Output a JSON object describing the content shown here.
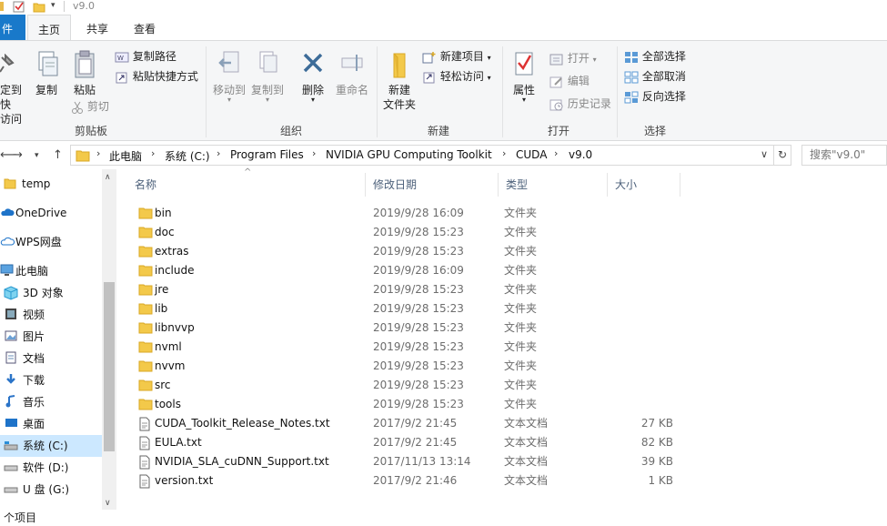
{
  "window": {
    "title": "v9.0"
  },
  "tabs": [
    {
      "label": "件"
    },
    {
      "label": "主页"
    },
    {
      "label": "共享"
    },
    {
      "label": "查看"
    }
  ],
  "ribbon": {
    "clipboard": {
      "pin_label_1": "定到快",
      "pin_label_2": "访问",
      "copy_label": "复制",
      "paste_label": "粘贴",
      "copy_path_label": "复制路径",
      "paste_shortcut_label": "粘贴快捷方式",
      "cut_label": "剪切",
      "group_label": "剪贴板"
    },
    "organize": {
      "move_to_label": "移动到",
      "copy_to_label": "复制到",
      "delete_label": "删除",
      "rename_label": "重命名",
      "group_label": "组织"
    },
    "new": {
      "new_folder_label_1": "新建",
      "new_folder_label_2": "文件夹",
      "new_item_label": "新建项目",
      "easy_access_label": "轻松访问",
      "group_label": "新建"
    },
    "open": {
      "properties_label": "属性",
      "open_label": "打开",
      "edit_label": "编辑",
      "history_label": "历史记录",
      "group_label": "打开"
    },
    "select": {
      "select_all_label": "全部选择",
      "select_none_label": "全部取消",
      "invert_label": "反向选择",
      "group_label": "选择"
    }
  },
  "address": {
    "crumbs": [
      "此电脑",
      "系统 (C:)",
      "Program Files",
      "NVIDIA GPU Computing Toolkit",
      "CUDA",
      "v9.0"
    ],
    "search_placeholder": "搜索\"v9.0\""
  },
  "nav": {
    "items": [
      {
        "label": "temp",
        "icon": "folder-icon"
      },
      {
        "label": "OneDrive",
        "icon": "cloud-icon"
      },
      {
        "label": "WPS网盘",
        "icon": "cloud-icon"
      },
      {
        "label": "此电脑",
        "icon": "computer-icon"
      },
      {
        "label": "3D 对象",
        "icon": "cube-icon"
      },
      {
        "label": "视频",
        "icon": "video-icon"
      },
      {
        "label": "图片",
        "icon": "picture-icon"
      },
      {
        "label": "文档",
        "icon": "document-icon"
      },
      {
        "label": "下载",
        "icon": "download-icon"
      },
      {
        "label": "音乐",
        "icon": "music-icon"
      },
      {
        "label": "桌面",
        "icon": "desktop-icon"
      },
      {
        "label": "系统 (C:)",
        "icon": "drive-icon"
      },
      {
        "label": "软件 (D:)",
        "icon": "drive-icon"
      },
      {
        "label": "U 盘 (G:)",
        "icon": "drive-icon"
      }
    ]
  },
  "columns": {
    "name": "名称",
    "date": "修改日期",
    "type": "类型",
    "size": "大小"
  },
  "files": [
    {
      "name": "bin",
      "date": "2019/9/28 16:09",
      "type": "文件夹",
      "size": "",
      "kind": "folder"
    },
    {
      "name": "doc",
      "date": "2019/9/28 15:23",
      "type": "文件夹",
      "size": "",
      "kind": "folder"
    },
    {
      "name": "extras",
      "date": "2019/9/28 15:23",
      "type": "文件夹",
      "size": "",
      "kind": "folder"
    },
    {
      "name": "include",
      "date": "2019/9/28 16:09",
      "type": "文件夹",
      "size": "",
      "kind": "folder"
    },
    {
      "name": "jre",
      "date": "2019/9/28 15:23",
      "type": "文件夹",
      "size": "",
      "kind": "folder"
    },
    {
      "name": "lib",
      "date": "2019/9/28 15:23",
      "type": "文件夹",
      "size": "",
      "kind": "folder"
    },
    {
      "name": "libnvvp",
      "date": "2019/9/28 15:23",
      "type": "文件夹",
      "size": "",
      "kind": "folder"
    },
    {
      "name": "nvml",
      "date": "2019/9/28 15:23",
      "type": "文件夹",
      "size": "",
      "kind": "folder"
    },
    {
      "name": "nvvm",
      "date": "2019/9/28 15:23",
      "type": "文件夹",
      "size": "",
      "kind": "folder"
    },
    {
      "name": "src",
      "date": "2019/9/28 15:23",
      "type": "文件夹",
      "size": "",
      "kind": "folder"
    },
    {
      "name": "tools",
      "date": "2019/9/28 15:23",
      "type": "文件夹",
      "size": "",
      "kind": "folder"
    },
    {
      "name": "CUDA_Toolkit_Release_Notes.txt",
      "date": "2017/9/2 21:45",
      "type": "文本文档",
      "size": "27 KB",
      "kind": "text"
    },
    {
      "name": "EULA.txt",
      "date": "2017/9/2 21:45",
      "type": "文本文档",
      "size": "82 KB",
      "kind": "text"
    },
    {
      "name": "NVIDIA_SLA_cuDNN_Support.txt",
      "date": "2017/11/13 13:14",
      "type": "文本文档",
      "size": "39 KB",
      "kind": "text"
    },
    {
      "name": "version.txt",
      "date": "2017/9/2 21:46",
      "type": "文本文档",
      "size": "1 KB",
      "kind": "text"
    }
  ],
  "status": {
    "count_text": "个项目"
  }
}
